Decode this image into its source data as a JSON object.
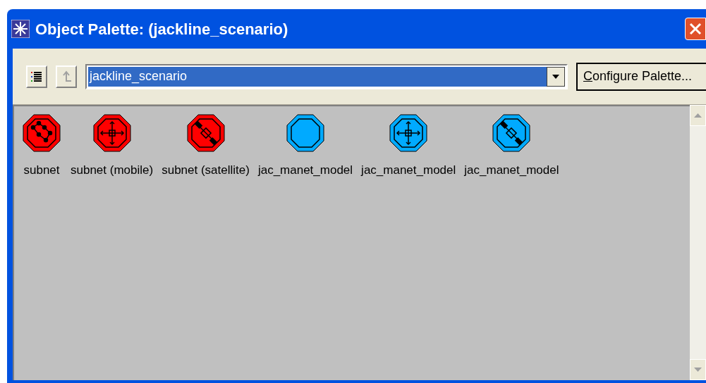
{
  "window": {
    "title": "Object Palette: (jackline_scenario)"
  },
  "toolbar": {
    "palette_select": {
      "value": "jackline_scenario"
    },
    "configure_button": "Configure Palette..."
  },
  "objects": [
    {
      "label": "subnet",
      "kind": "network",
      "color": "#ff0000"
    },
    {
      "label": "subnet (mobile)",
      "kind": "mobile",
      "color": "#ff0000"
    },
    {
      "label": "subnet (satellite)",
      "kind": "satellite",
      "color": "#ff0000"
    },
    {
      "label": "jac_manet_model",
      "kind": "plain",
      "color": "#00aaff"
    },
    {
      "label": "jac_manet_model",
      "kind": "mobile",
      "color": "#00aaff"
    },
    {
      "label": "jac_manet_model",
      "kind": "satellite",
      "color": "#00aaff"
    }
  ]
}
